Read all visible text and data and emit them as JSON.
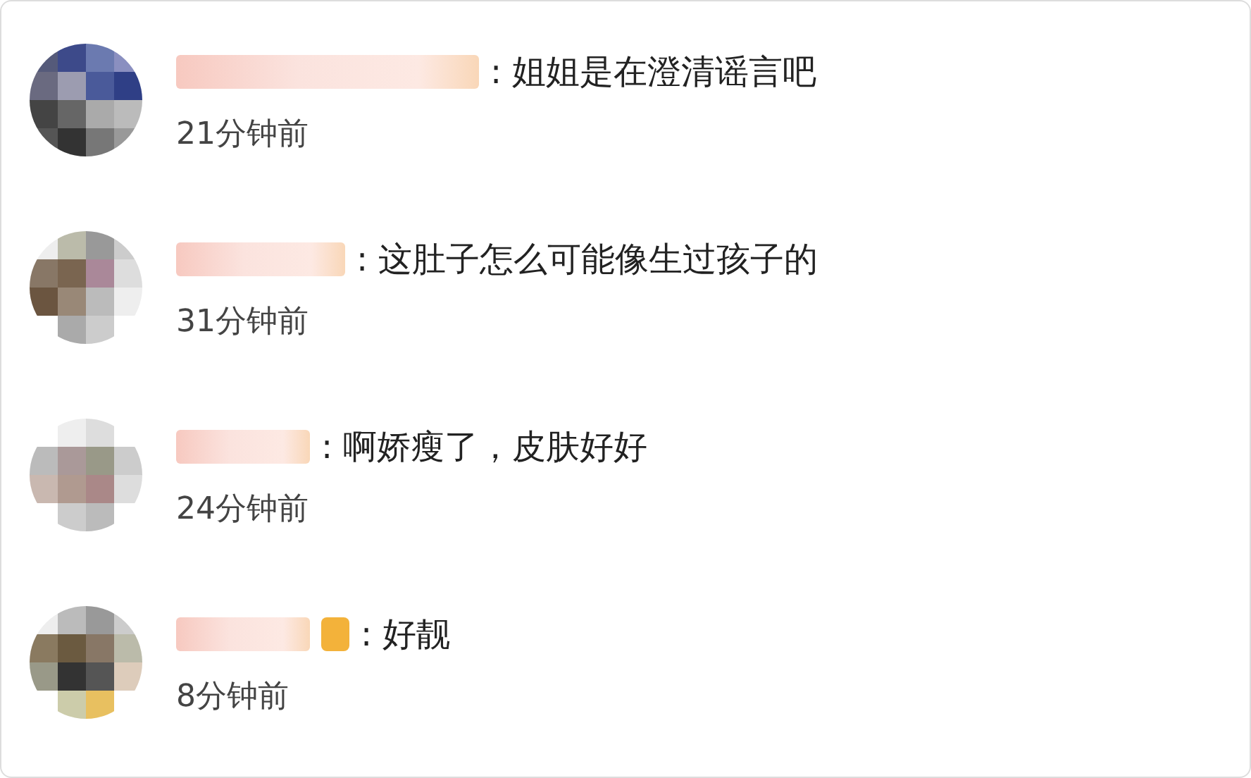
{
  "comments": [
    {
      "text": ": 姐姐是在澄清谣言吧",
      "time": "21分钟前",
      "badge": false
    },
    {
      "text": ": 这肚子怎么可能像生过孩子的",
      "time": "31分钟前",
      "badge": false
    },
    {
      "text": ": 啊娇瘦了，皮肤好好",
      "time": "24分钟前",
      "badge": false
    },
    {
      "text": ": 好靓",
      "time": "8分钟前",
      "badge": true
    }
  ]
}
